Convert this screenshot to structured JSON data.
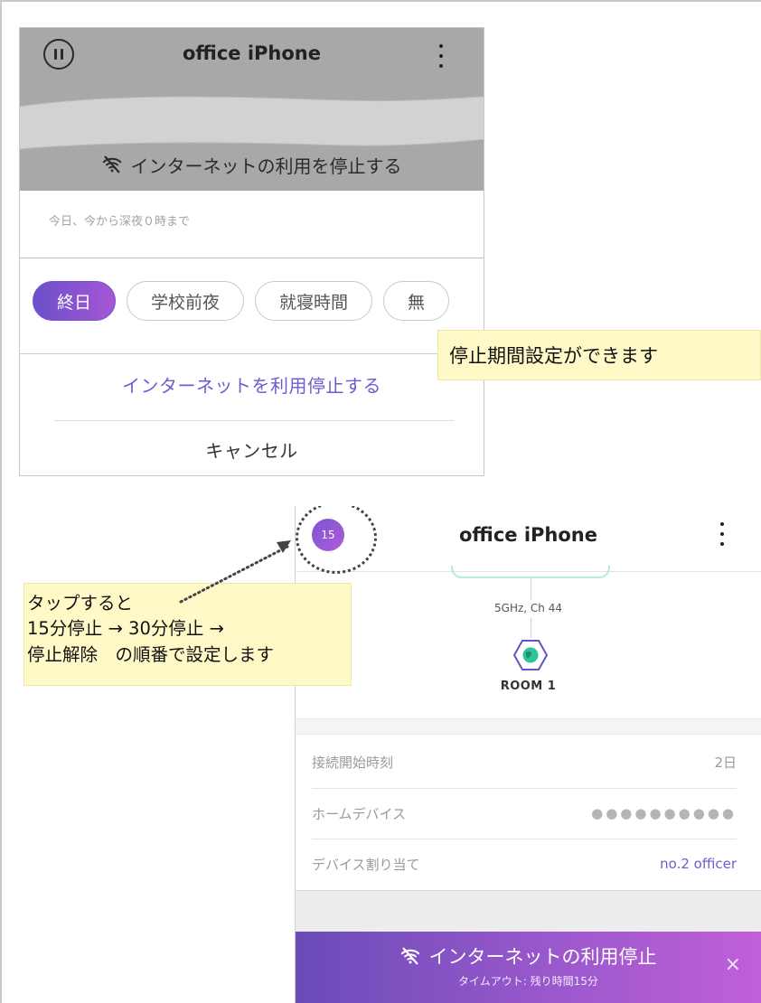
{
  "panel1": {
    "title": "office iPhone",
    "stop_internet_label": "インターネットの利用を停止する",
    "range_text": "今日、今から深夜０時まで",
    "chips": [
      "終日",
      "学校前夜",
      "就寝時間",
      "無"
    ],
    "confirm_label": "インターネットを利用停止する",
    "cancel_label": "キャンセル"
  },
  "callout1": {
    "text": "停止期間設定ができます"
  },
  "panel2": {
    "badge": "15",
    "title": "office iPhone",
    "band": "5GHz, Ch 44",
    "room": "ROOM 1",
    "rows": [
      {
        "label": "接続開始時刻",
        "value": "2日"
      },
      {
        "label": "ホームデバイス",
        "value": "●●●●●●●●●●"
      },
      {
        "label": "デバイス割り当て",
        "value": "no.2 officer"
      }
    ],
    "banner_title": "インターネットの利用停止",
    "banner_sub": "タイムアウト: 残り時間15分",
    "banner_close": "×"
  },
  "callout2": {
    "line1": "タップすると",
    "line2": "15分停止 → 30分停止 →",
    "line3": "停止解除　の順番で設定します"
  },
  "colors": {
    "accent_purple": "#6d5ccf",
    "gradient_start": "#6a4bb8",
    "gradient_end": "#c15fd9",
    "callout_bg": "#fff9c8",
    "header_grey": "#a8a8a8"
  }
}
